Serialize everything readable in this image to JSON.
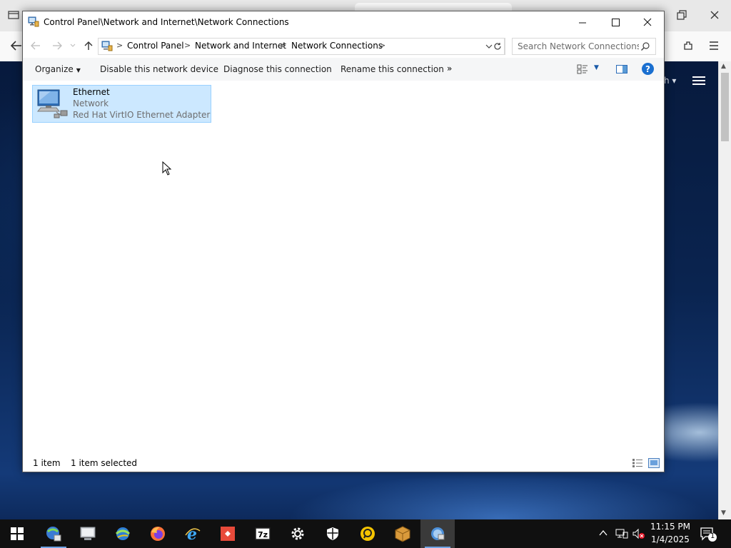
{
  "window": {
    "title": "Control Panel\\Network and Internet\\Network Connections",
    "caption_buttons": [
      "minimize",
      "maximize",
      "close"
    ]
  },
  "address_bar": {
    "crumbs": [
      "Control Panel",
      "Network and Internet",
      "Network Connections"
    ],
    "separator": ">"
  },
  "search": {
    "placeholder": "Search Network Connections"
  },
  "command_bar": {
    "organize": "Organize",
    "disable": "Disable this network device",
    "diagnose": "Diagnose this connection",
    "rename": "Rename this connection",
    "more": "»",
    "help": "?"
  },
  "items": [
    {
      "name": "Ethernet",
      "network": "Network",
      "adapter": "Red Hat VirtIO Ethernet Adapter",
      "selected": true
    }
  ],
  "status_bar": {
    "count": "1 item",
    "selected": "1 item selected"
  },
  "taskbar": {
    "apps": [
      "start-button",
      "network-app-icon",
      "computer-app-icon",
      "globe-network-app-icon",
      "firefox-icon",
      "internet-explorer-icon",
      "git-app-icon",
      "7zip-icon",
      "settings-gear-icon",
      "security-shield-icon",
      "remote-desktop-app-icon",
      "package-app-icon",
      "network-connections-app-icon"
    ],
    "active_app": "network-connections-app-icon",
    "clock_time": "11:15 PM",
    "clock_date": "1/4/2025",
    "notification_count": "1"
  },
  "colors": {
    "selection_fill": "#cce8ff",
    "selection_border": "#99d1ff",
    "help_blue": "#1a6fd0",
    "taskbar": "#101010",
    "accent_underline": "#6fa3e4"
  }
}
